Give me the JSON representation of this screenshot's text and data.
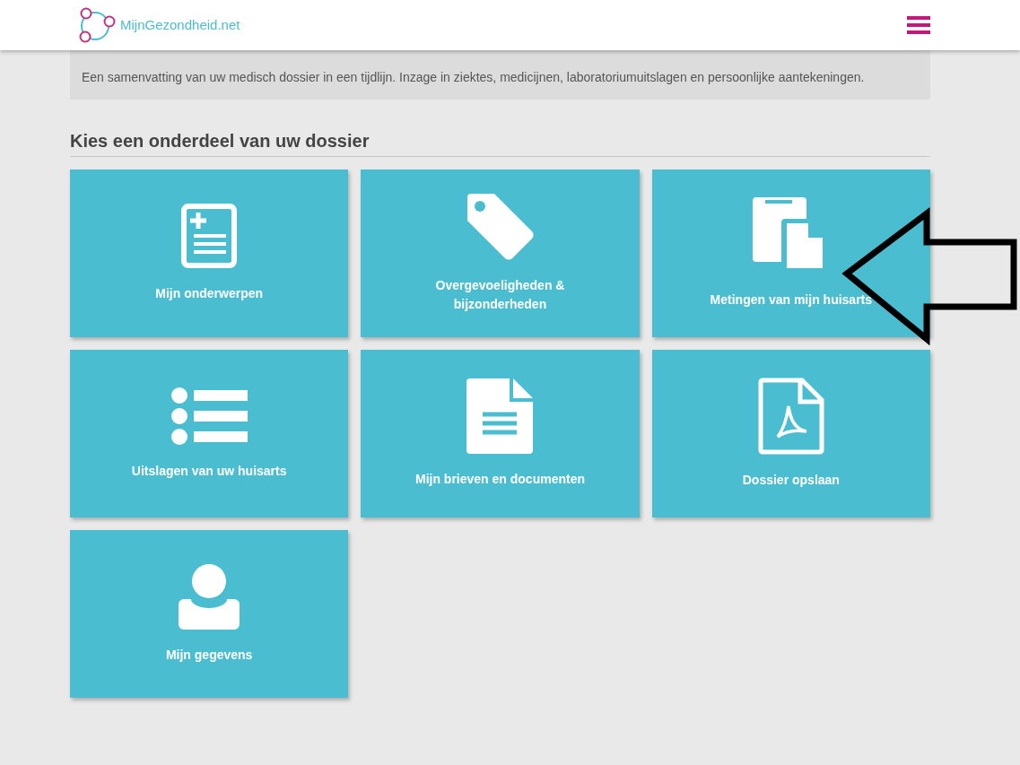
{
  "header": {
    "logo_text": "MijnGezondheid.net"
  },
  "intro": {
    "text": "Een samenvatting van uw medisch dossier in een tijdlijn. Inzage in ziektes, medicijnen, laboratoriumuitslagen en persoonlijke aantekeningen."
  },
  "section": {
    "title": "Kies een onderdeel van uw dossier"
  },
  "tiles": [
    {
      "kind": "record",
      "label": "Mijn onderwerpen"
    },
    {
      "kind": "tag",
      "label": "Overgevoeligheden & bijzonderheden"
    },
    {
      "kind": "copy",
      "label": "Metingen van mijn huisarts"
    },
    {
      "kind": "list",
      "label": "Uitslagen van uw huisarts"
    },
    {
      "kind": "document",
      "label": "Mijn brieven en documenten"
    },
    {
      "kind": "pdf",
      "label": "Dossier opslaan"
    },
    {
      "kind": "person",
      "label": "Mijn gegevens"
    }
  ]
}
